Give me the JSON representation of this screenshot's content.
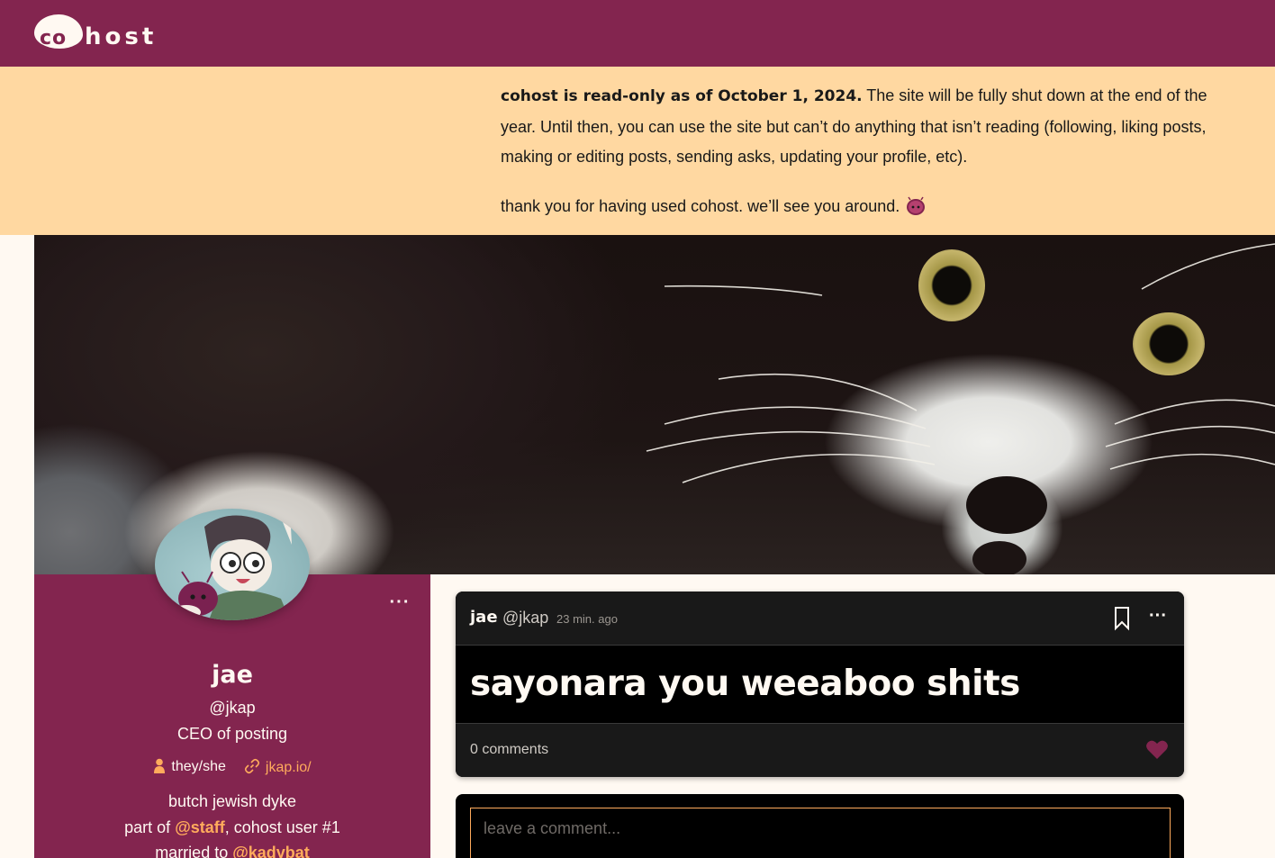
{
  "app": {
    "logo_text_co": "co",
    "logo_text_host": "host"
  },
  "banner": {
    "bold": "cohost is read-only as of October 1, 2024.",
    "body": " The site will be fully shut down at the end of the year. Until then, you can use the site but can’t do anything that isn’t reading (following, liking posts, making or editing posts, sending asks, updating your profile, etc).",
    "thanks": "thank you for having used cohost. we’ll see you around."
  },
  "profile": {
    "display_name": "jae",
    "handle": "@jkap",
    "headline": "CEO of posting",
    "pronouns": "they/she",
    "url": "jkap.io/",
    "bio_line1": "butch jewish dyke",
    "bio_line2_prefix": "part of ",
    "bio_line2_mention": "@staff",
    "bio_line2_suffix": ", cohost user #1",
    "bio_line3_prefix": "married to ",
    "bio_line3_mention": "@kadybat",
    "menu_label": "···"
  },
  "post": {
    "author_name": "jae",
    "author_handle": "@jkap",
    "timestamp": "23 min. ago",
    "title": "sayonara you weeaboo shits",
    "comments": "0 comments",
    "menu_label": "···"
  },
  "comment_box": {
    "placeholder": "leave a comment..."
  },
  "icons": {
    "person": "person-icon",
    "link": "link-icon",
    "bookmark": "bookmark-icon",
    "heart": "heart-icon",
    "eggbug": "eggbug-icon"
  },
  "colors": {
    "brand": "#83254f",
    "banner_bg": "#ffd8a1",
    "accent": "#ffab5c",
    "post_bg": "#000000",
    "page_bg": "#fff9f2"
  }
}
